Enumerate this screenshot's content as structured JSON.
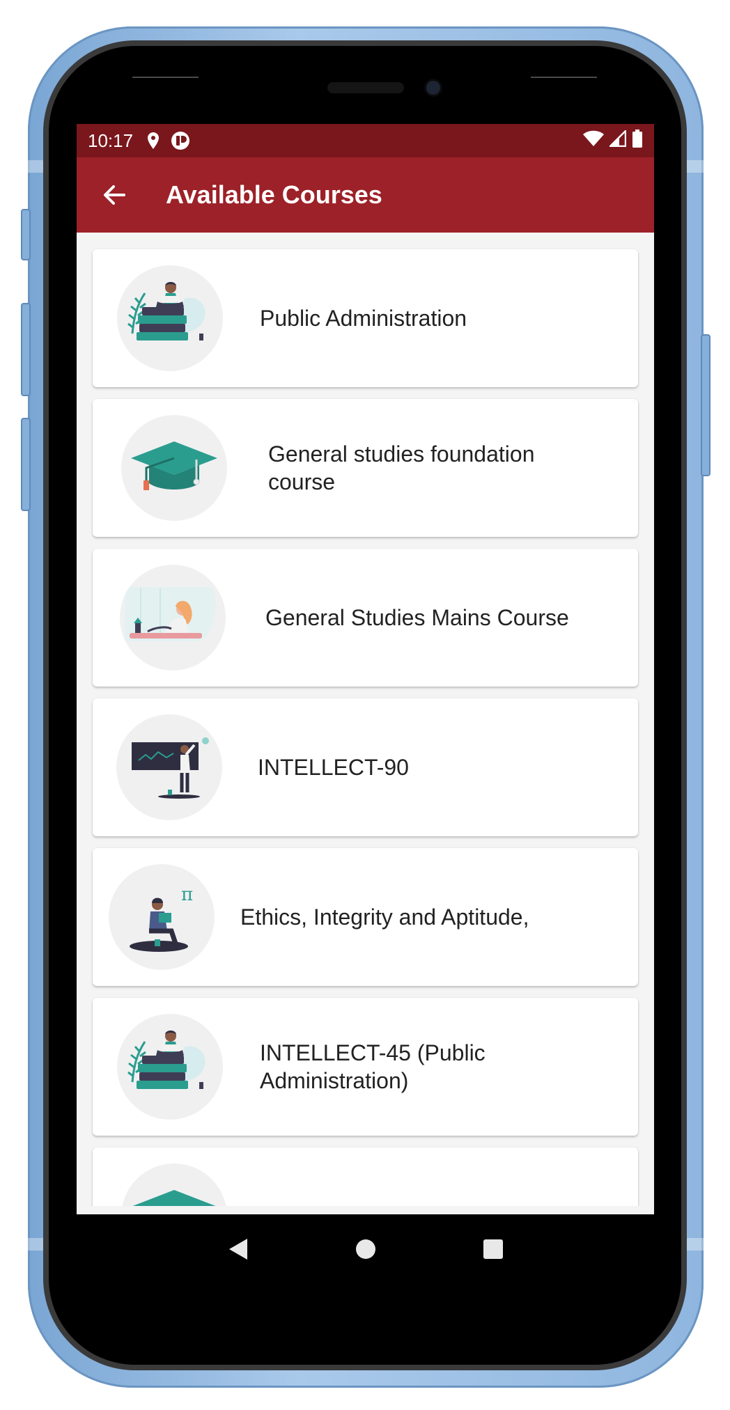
{
  "status_bar": {
    "time": "10:17",
    "icons": [
      "location-pin-icon",
      "app-notification-icon",
      "wifi-icon",
      "signal-icon",
      "battery-icon"
    ]
  },
  "app_bar": {
    "title": "Available Courses",
    "back_icon": "arrow-left-icon"
  },
  "courses": [
    {
      "title": "Public Administration",
      "illustration": "reader-on-books"
    },
    {
      "title": "General studies foundation course",
      "illustration": "graduation-cap"
    },
    {
      "title": "General Studies Mains Course",
      "illustration": "person-studying-at-desk"
    },
    {
      "title": "INTELLECT-90",
      "illustration": "teacher-at-blackboard"
    },
    {
      "title": "Ethics, Integrity and Aptitude,",
      "illustration": "person-reading-with-pi"
    },
    {
      "title": "INTELLECT-45 (Public Administration)",
      "illustration": "reader-on-books"
    },
    {
      "title": "",
      "illustration": "graduation-cap"
    }
  ],
  "nav_bar": {
    "icons": [
      "back-triangle-icon",
      "home-circle-icon",
      "recents-square-icon"
    ]
  },
  "colors": {
    "status_bar": "#7a171c",
    "app_bar": "#9d2128",
    "accent_teal": "#2a9d8f",
    "background": "#f4f4f4"
  }
}
